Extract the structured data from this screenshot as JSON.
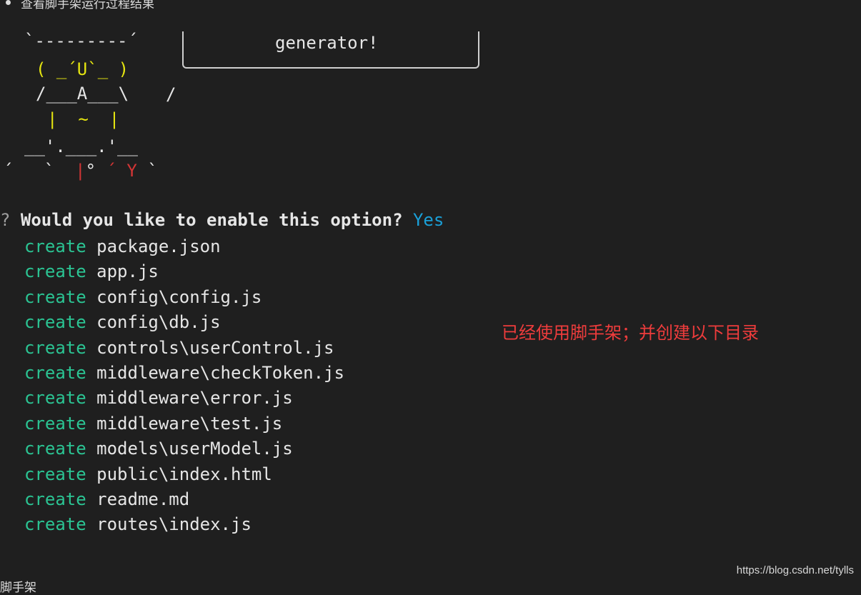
{
  "heading": {
    "text": "查看脚手架运行过程结果"
  },
  "ascii_art": {
    "line1": "`---------´",
    "line2": "( _´U`_ )",
    "line3": "/___A___\\",
    "line4": "|  ~  |",
    "line5": "__'.___.'__",
    "line6_prefix": "´   `  ",
    "line6_bar": "|",
    "line6_mid": "° ",
    "line6_red": "´ Y",
    "line6_suffix": " `",
    "slash": "/",
    "box_text": "generator!"
  },
  "prompt": {
    "mark": "?",
    "question": "Would you like to enable this option?",
    "answer": "Yes"
  },
  "files": [
    {
      "action": "create",
      "path": "package.json"
    },
    {
      "action": "create",
      "path": "app.js"
    },
    {
      "action": "create",
      "path": "config\\config.js"
    },
    {
      "action": "create",
      "path": "config\\db.js"
    },
    {
      "action": "create",
      "path": "controls\\userControl.js"
    },
    {
      "action": "create",
      "path": "middleware\\checkToken.js"
    },
    {
      "action": "create",
      "path": "middleware\\error.js"
    },
    {
      "action": "create",
      "path": "middleware\\test.js"
    },
    {
      "action": "create",
      "path": "models\\userModel.js"
    },
    {
      "action": "create",
      "path": "public\\index.html"
    },
    {
      "action": "create",
      "path": "readme.md"
    },
    {
      "action": "create",
      "path": "routes\\index.js"
    }
  ],
  "annotation": {
    "text": "已经使用脚手架；并创建以下目录"
  },
  "watermark": {
    "text": "https://blog.csdn.net/tylls"
  },
  "footer": {
    "text": "脚手架"
  },
  "colors": {
    "background": "#1f1f1f",
    "keyword_green": "#2bc493",
    "answer_blue": "#1aa0d8",
    "art_yellow": "#e5e510",
    "art_red": "#d33535",
    "annotation_red": "#ee3c3c"
  }
}
